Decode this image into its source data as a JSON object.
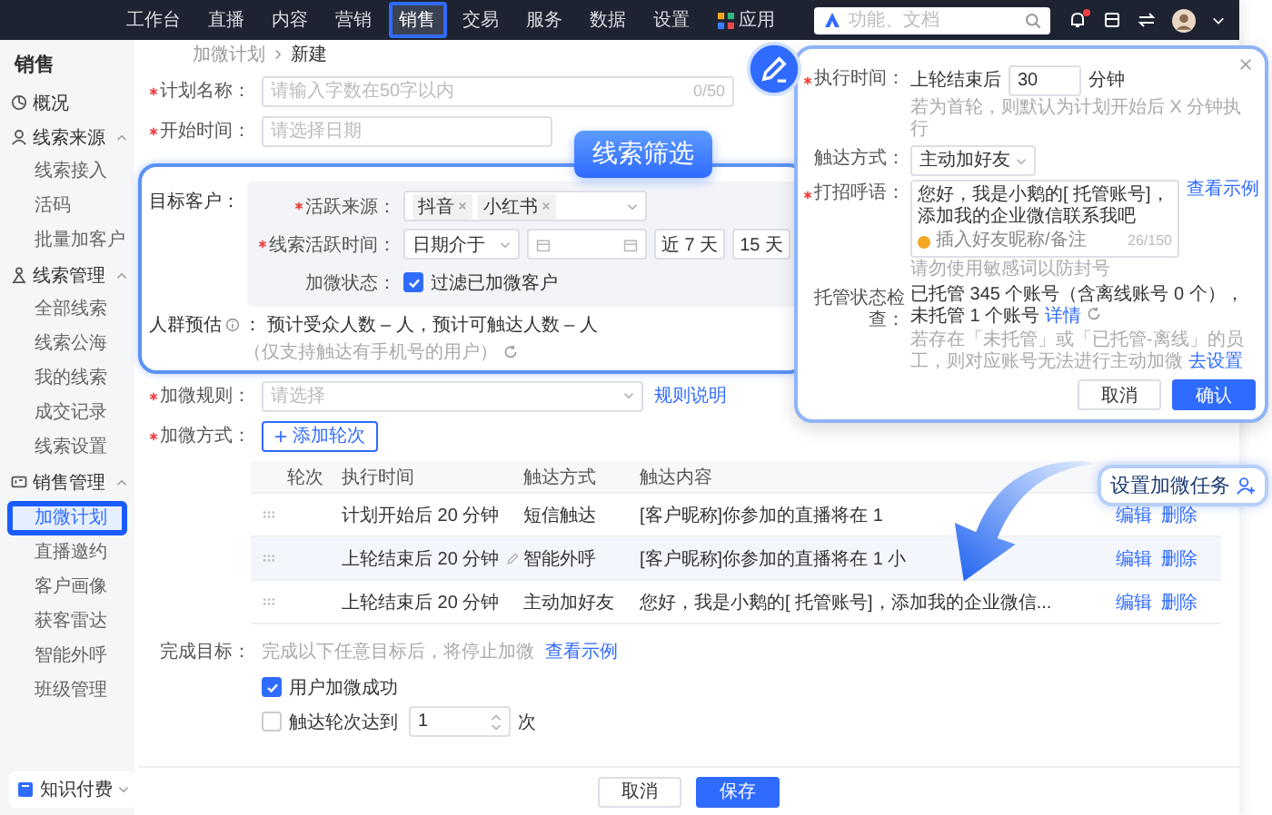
{
  "top_nav": {
    "items": [
      {
        "label": "工作台",
        "kind": "text",
        "selected": false
      },
      {
        "label": "直播",
        "kind": "text",
        "selected": false
      },
      {
        "label": "内容",
        "kind": "text",
        "selected": false
      },
      {
        "label": "营销",
        "kind": "text",
        "selected": false
      },
      {
        "label": "销售",
        "kind": "text",
        "selected": true
      },
      {
        "label": "交易",
        "kind": "text",
        "selected": false
      },
      {
        "label": "服务",
        "kind": "text",
        "selected": false
      },
      {
        "label": "数据",
        "kind": "text",
        "selected": false
      },
      {
        "label": "设置",
        "kind": "text",
        "selected": false
      },
      {
        "label": "应用",
        "kind": "apps",
        "selected": false
      }
    ],
    "search": {
      "placeholder": "功能、文档"
    },
    "unread": true
  },
  "sidebar": {
    "title": "销售",
    "groups": [
      {
        "label": "概况"
      },
      {
        "label": "线索来源",
        "expanded": true,
        "children": [
          {
            "label": "线索接入",
            "selected": false
          },
          {
            "label": "活码",
            "selected": false
          },
          {
            "label": "批量加客户",
            "selected": false
          }
        ]
      },
      {
        "label": "线索管理",
        "expanded": true,
        "children": [
          {
            "label": "全部线索",
            "selected": false
          },
          {
            "label": "线索公海",
            "selected": false
          },
          {
            "label": "我的线索",
            "selected": false
          },
          {
            "label": "成交记录",
            "selected": false
          },
          {
            "label": "线索设置",
            "selected": false
          }
        ]
      },
      {
        "label": "销售管理",
        "expanded": true,
        "children": [
          {
            "label": "加微计划",
            "selected": true
          },
          {
            "label": "直播邀约",
            "selected": false
          },
          {
            "label": "客户画像",
            "selected": false
          },
          {
            "label": "获客雷达",
            "selected": false
          },
          {
            "label": "智能外呼",
            "selected": false
          },
          {
            "label": "班级管理",
            "selected": false
          }
        ]
      }
    ],
    "footer": "知识付费"
  },
  "breadcrumb": [
    "加微计划",
    "新建"
  ],
  "form": {
    "plan_name": {
      "label": "计划名称：",
      "required": true,
      "placeholder": "请输入字数在50字以内",
      "counter": "0/50"
    },
    "start_time": {
      "label": "开始时间：",
      "required": true,
      "placeholder": "请选择日期"
    },
    "target": {
      "label": "目标客户：",
      "callout": "线索筛选",
      "source": {
        "label": "活跃来源：",
        "required": true,
        "tags": [
          "抖音",
          "小红书"
        ]
      },
      "active_time": {
        "label": "线索活跃时间：",
        "required": true,
        "mode": "日期介于",
        "quick": [
          "近 7 天",
          "15 天"
        ]
      },
      "status": {
        "label": "加微状态：",
        "checked": true,
        "text": "过滤已加微客户"
      },
      "estimate": {
        "label": "人群预估",
        "text": "： 预计受众人数 – 人，预计可触达人数 – 人",
        "note": "（仅支持触达有手机号的用户）"
      }
    },
    "rule": {
      "label": "加微规则：",
      "required": true,
      "placeholder": "请选择",
      "link": "规则说明"
    },
    "method": {
      "label": "加微方式：",
      "required": true,
      "add": "添加轮次"
    },
    "table": {
      "columns": [
        "轮次",
        "执行时间",
        "触达方式",
        "触达内容"
      ],
      "rows": [
        {
          "time": "计划开始后 20 分钟",
          "channel": "短信触达",
          "content": "[客户昵称]你参加的直播将在 1",
          "edit": "编辑",
          "delete": "删除",
          "hovered": false
        },
        {
          "time": "上轮结束后 20 分钟",
          "channel": "智能外呼",
          "content": "[客户昵称]你参加的直播将在 1 小",
          "edit": "编辑",
          "delete": "删除",
          "hovered": true
        },
        {
          "time": "上轮结束后 20 分钟",
          "channel": "主动加好友",
          "content": "您好，我是小鹅的[ 托管账号]，添加我的企业微信...",
          "edit": "编辑",
          "delete": "删除",
          "hovered": false
        }
      ]
    },
    "goal": {
      "label": "完成目标：",
      "hint": "完成以下任意目标后，将停止加微",
      "link": "查看示例",
      "options": [
        {
          "kind": "check",
          "label": "用户加微成功",
          "checked": true
        },
        {
          "kind": "count",
          "label": "触达轮次达到",
          "checked": false,
          "value": "1",
          "unit": "次"
        }
      ]
    },
    "footer": {
      "cancel": "取消",
      "save": "保存"
    }
  },
  "popup": {
    "exec": {
      "label": "执行时间：",
      "required": true,
      "prefix": "上轮结束后",
      "value": "30",
      "unit": "分钟",
      "hint": "若为首轮，则默认为计划开始后 X 分钟执行"
    },
    "channel": {
      "label": "触达方式：",
      "value": "主动加好友"
    },
    "greeting": {
      "label": "打招呼语：",
      "required": true,
      "text": "您好，我是小鹅的[ 托管账号]，添加我的企业微信联系我吧",
      "insert": "插入好友昵称/备注",
      "counter": "26/150",
      "link": "查看示例",
      "hint": "请勿使用敏感词以防封号"
    },
    "hosting": {
      "label": "托管状态检查：",
      "text": "已托管 345 个账号（含离线账号 0 个），未托管 1 个账号",
      "link": "详情",
      "hint": "若存在「未托管」或「已托管-离线」的员工，则对应账号无法进行主动加微",
      "hint_link": "去设置"
    },
    "buttons": {
      "cancel": "取消",
      "confirm": "确认"
    }
  },
  "task_callout": "设置加微任务"
}
